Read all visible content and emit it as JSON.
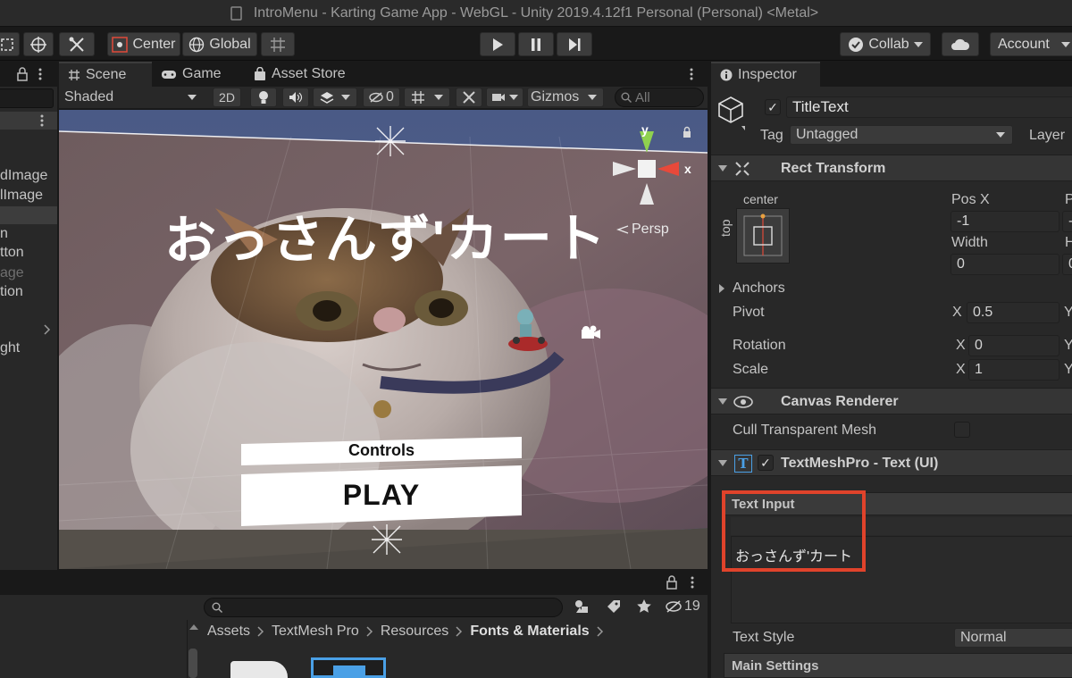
{
  "window": {
    "title": "IntroMenu - Karting Game App - WebGL - Unity 2019.4.12f1 Personal (Personal) <Metal>"
  },
  "toolbar": {
    "center_label": "Center",
    "global_label": "Global",
    "collab_label": "Collab",
    "account_label": "Account"
  },
  "scene_panel": {
    "tabs": [
      {
        "label": "Scene"
      },
      {
        "label": "Game"
      },
      {
        "label": "Asset Store"
      }
    ],
    "shading_mode": "Shaded",
    "mode_2d": "2D",
    "hidden_count": "0",
    "gizmos_label": "Gizmos",
    "search_placeholder": "All",
    "persp_label": "Persp",
    "axis_x": "x",
    "axis_y": "y",
    "title_text": "おっさんず'カート",
    "controls_label": "Controls",
    "play_label": "PLAY"
  },
  "hierarchy": {
    "items": [
      "dImage",
      "lImage",
      "n",
      "tton",
      "age",
      "tion",
      "ght"
    ]
  },
  "project": {
    "breadcrumb": [
      "Assets",
      "TextMesh Pro",
      "Resources",
      "Fonts & Materials"
    ],
    "hidden_count": "19"
  },
  "inspector": {
    "tab_label": "Inspector",
    "object_name": "TitleText",
    "tag_label": "Tag",
    "tag_value": "Untagged",
    "layer_label": "Layer",
    "rect_transform": {
      "title": "Rect Transform",
      "anchor_h": "center",
      "anchor_v": "top",
      "pos_x_label": "Pos X",
      "pos_y_label_partial": "P",
      "pos_x_value": "-1",
      "pos_y_value_partial": "-",
      "width_label": "Width",
      "height_label_partial": "H",
      "width_value": "0",
      "height_value_partial": "0",
      "anchors_label": "Anchors",
      "pivot_label": "Pivot",
      "pivot_x": "0.5",
      "rotation_label": "Rotation",
      "rotation_x": "0",
      "scale_label": "Scale",
      "scale_x": "1",
      "x_label": "X",
      "y_label": "Y"
    },
    "canvas_renderer": {
      "title": "Canvas Renderer",
      "cull_label": "Cull Transparent Mesh"
    },
    "textmeshpro": {
      "title": "TextMeshPro - Text (UI)",
      "text_input_label": "Text Input",
      "text_value": "おっさんず'カート",
      "text_style_label": "Text Style",
      "text_style_value": "Normal",
      "main_settings_label": "Main Settings"
    }
  },
  "colors": {
    "highlight": "#e0432b",
    "link_blue": "#4aa0e6",
    "panel": "#282828"
  }
}
